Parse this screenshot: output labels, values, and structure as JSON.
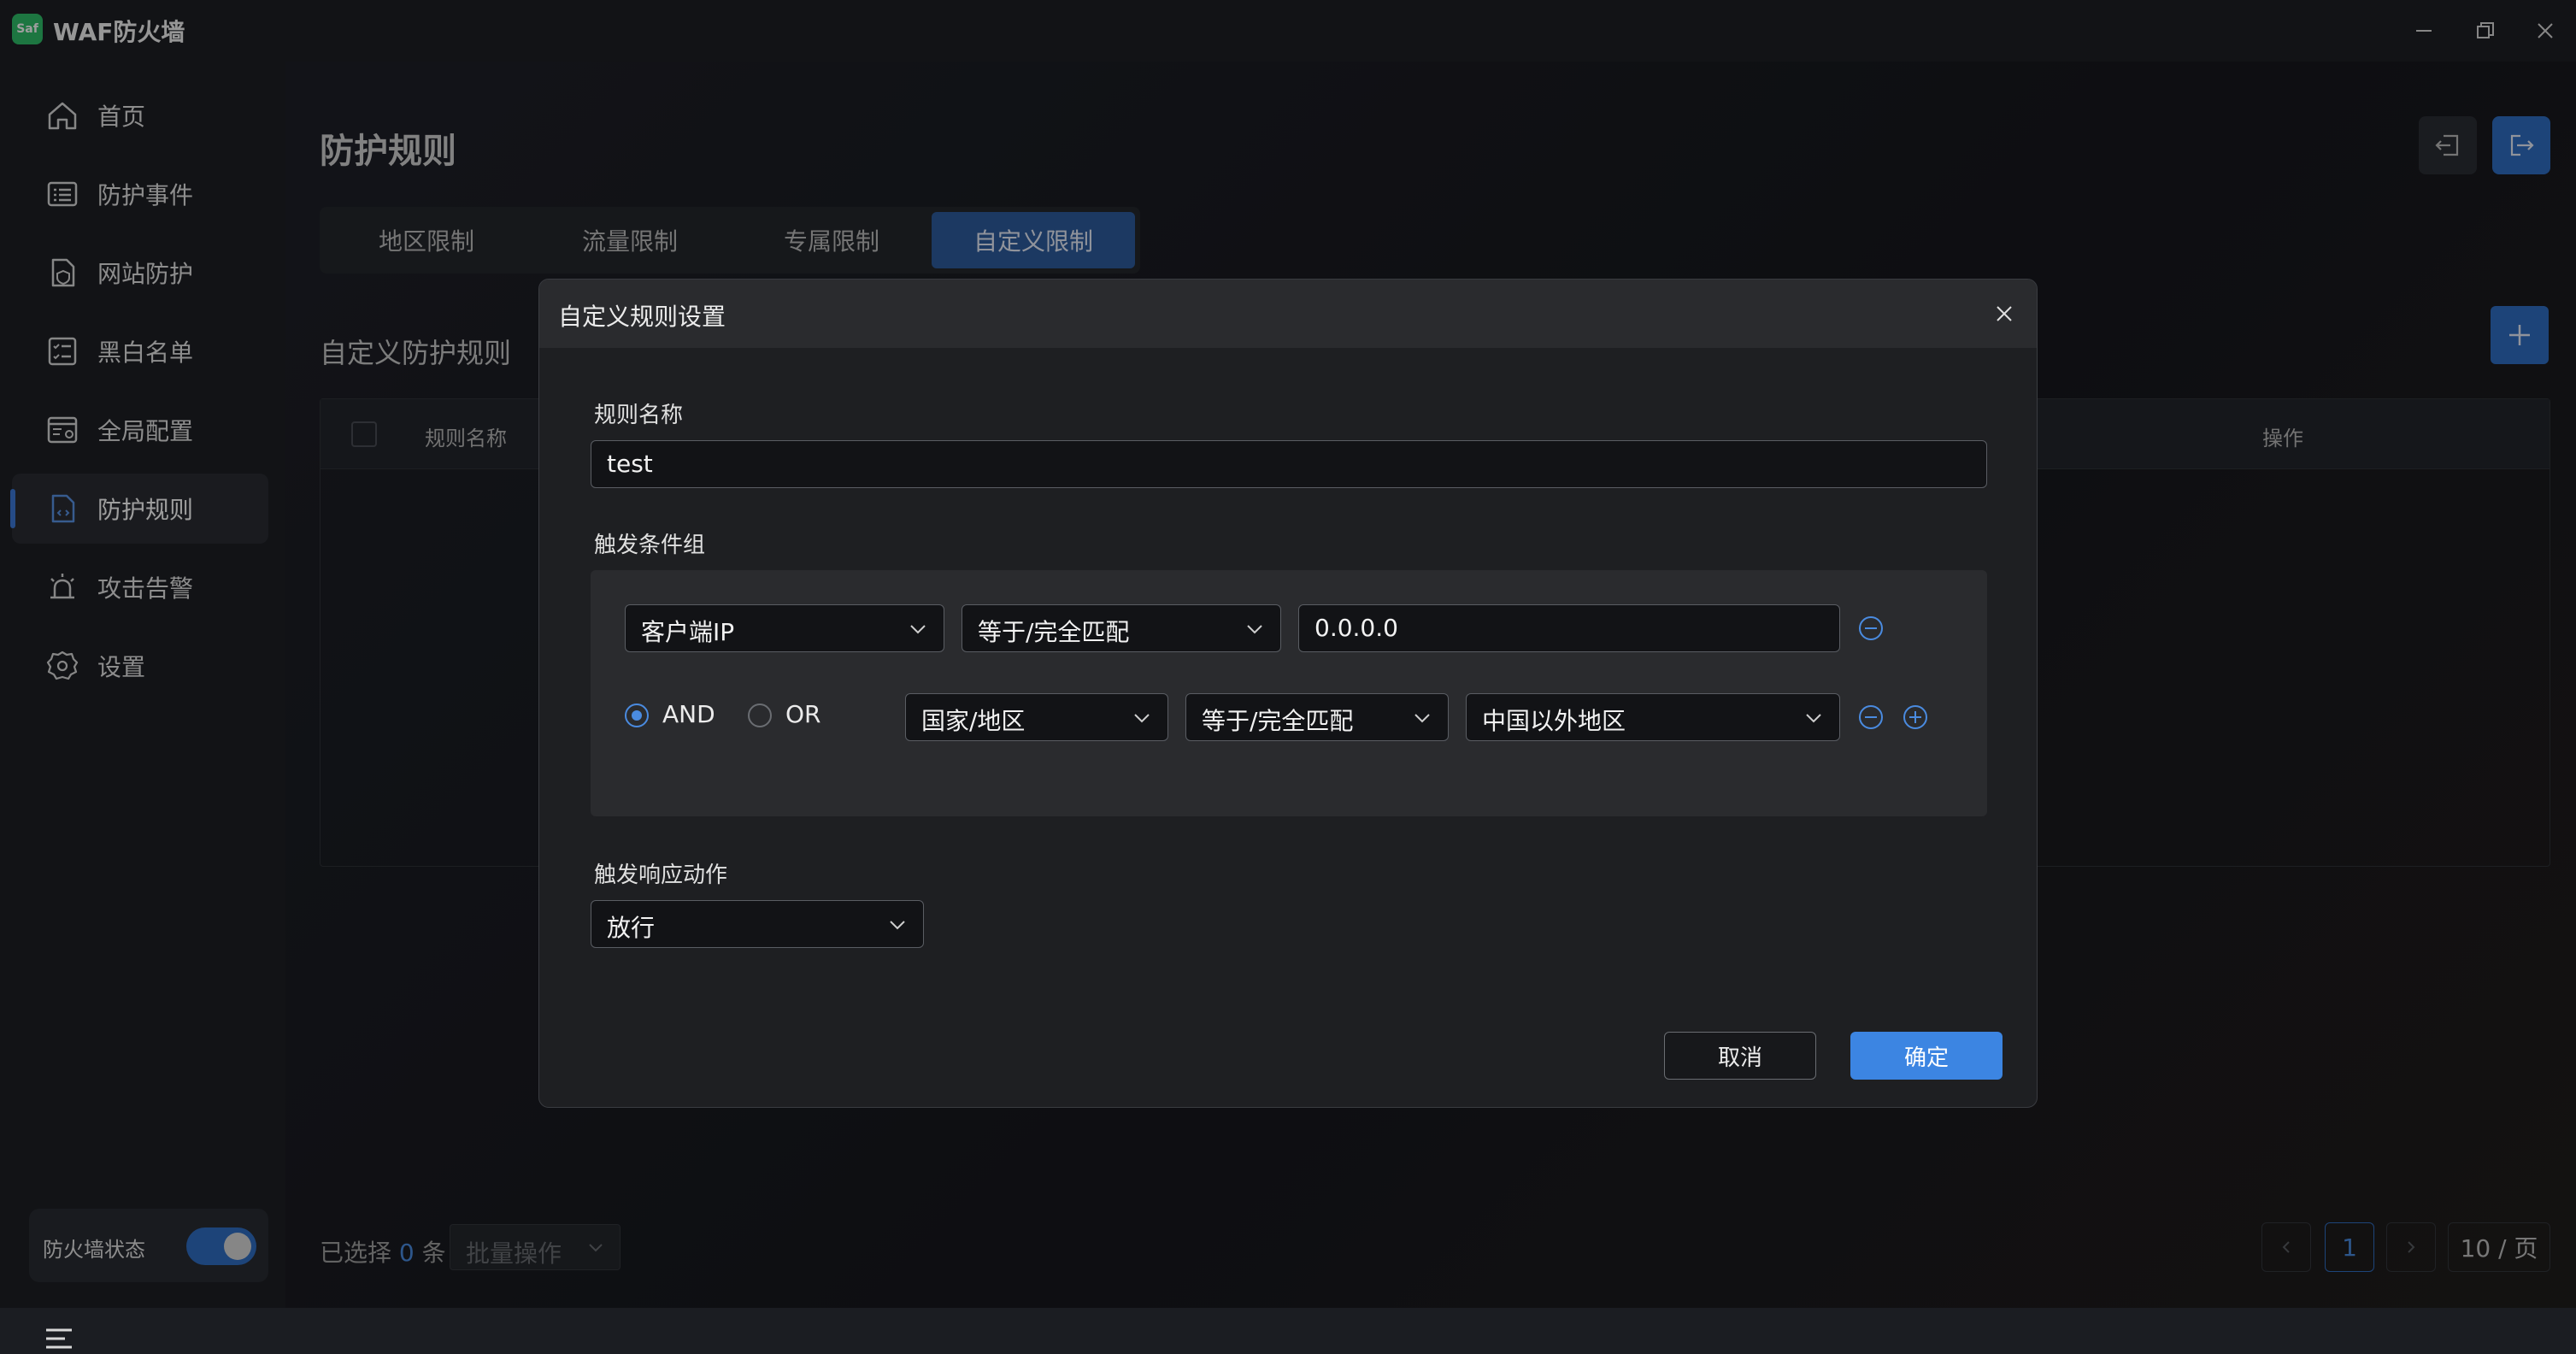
{
  "app": {
    "title": "WAF防火墙",
    "logo_text": "Saf"
  },
  "sidebar": {
    "items": [
      {
        "label": "首页",
        "icon": "home-icon"
      },
      {
        "label": "防护事件",
        "icon": "event-list-icon"
      },
      {
        "label": "网站防护",
        "icon": "website-shield-icon"
      },
      {
        "label": "黑白名单",
        "icon": "checklist-icon"
      },
      {
        "label": "全局配置",
        "icon": "config-window-icon"
      },
      {
        "label": "防护规则",
        "icon": "rule-file-icon",
        "active": true
      },
      {
        "label": "攻击告警",
        "icon": "alarm-icon"
      },
      {
        "label": "设置",
        "icon": "gear-icon"
      }
    ],
    "firewall_status": {
      "label": "防火墙状态",
      "enabled": true
    }
  },
  "page": {
    "title": "防护规则",
    "tabs": [
      "地区限制",
      "流量限制",
      "专属限制",
      "自定义限制"
    ],
    "active_tab": "自定义限制",
    "section_title": "自定义防护规则",
    "table": {
      "columns": [
        "规则名称",
        "操作"
      ]
    },
    "footer": {
      "selected_prefix": "已选择",
      "selected_count": "0",
      "selected_suffix": "条",
      "batch_placeholder": "批量操作",
      "current_page": "1",
      "page_size": "10 / 页"
    }
  },
  "modal": {
    "title": "自定义规则设置",
    "name_label": "规则名称",
    "name_value": "test",
    "conditions_label": "触发条件组",
    "conditions": [
      {
        "field": "客户端IP",
        "operator": "等于/完全匹配",
        "value": "0.0.0.0"
      },
      {
        "logic_and": "AND",
        "logic_or": "OR",
        "logic_selected": "AND",
        "field": "国家/地区",
        "operator": "等于/完全匹配",
        "value": "中国以外地区"
      }
    ],
    "action_label": "触发响应动作",
    "action_value": "放行",
    "cancel_label": "取消",
    "ok_label": "确定"
  },
  "colors": {
    "accent": "#3c85e2",
    "tab_active": "#2e5d9e",
    "logo": "#2fbf6a"
  }
}
